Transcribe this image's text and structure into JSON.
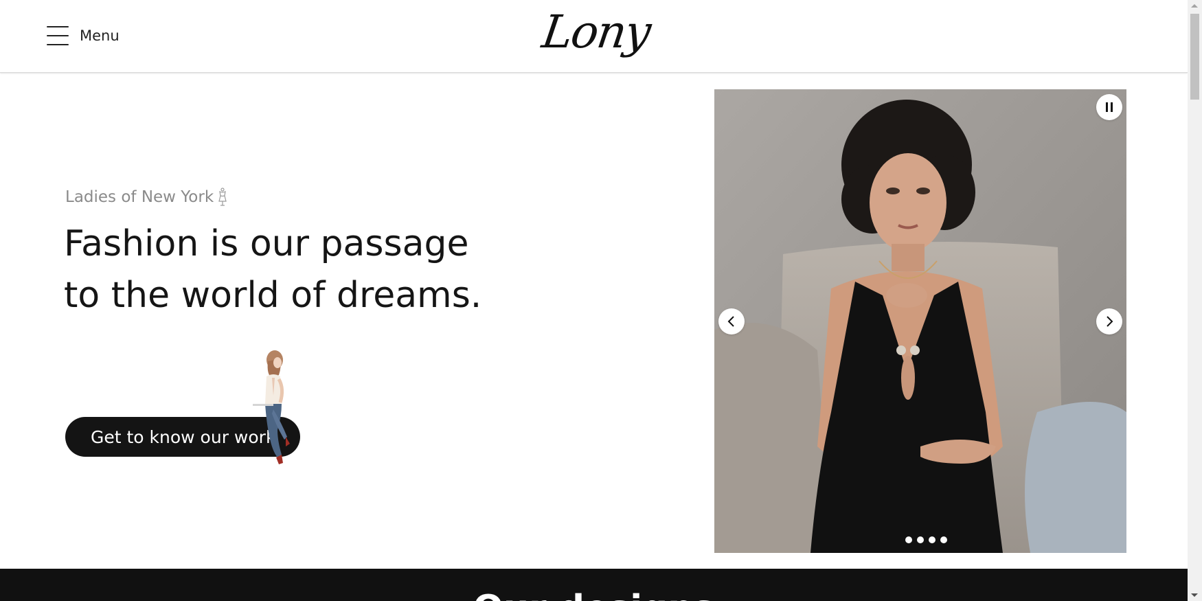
{
  "header": {
    "menu_label": "Menu",
    "logo_text": "Lony"
  },
  "hero": {
    "eyebrow": "Ladies of New York",
    "eyebrow_icon": "dress-form-icon",
    "headline_line1": "Fashion is our passage",
    "headline_line2": "to the world of dreams.",
    "cta_label": "Get to know our work"
  },
  "slideshow": {
    "pause_icon": "pause-icon",
    "prev_icon": "chevron-left-icon",
    "next_icon": "chevron-right-icon",
    "slide_count": 4
  },
  "dark_section": {
    "heading": "Our designs"
  },
  "colors": {
    "accent": "#141414",
    "muted_text": "#8a8a8a",
    "band": "#111111"
  }
}
